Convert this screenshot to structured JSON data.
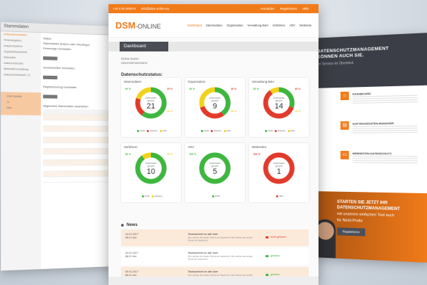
{
  "colors": {
    "accent": "#f27b19",
    "green": "#3fb63f",
    "yellow": "#f2d21b",
    "red": "#e23b2c",
    "dark": "#4a4d55"
  },
  "topbar": {
    "phone": "+49 0 00 0000-0",
    "email": "info@dsm-online.eu",
    "login": "Anmelden",
    "register": "Registrieren",
    "help": "Hilfe"
  },
  "logo": {
    "brand": "DSM",
    "suffix": "-ONLINE",
    "tagline": "Datenschutzmanagement"
  },
  "nav": [
    "Dashboard",
    "Stammdaten",
    "Organisation",
    "Verwaltung B&V",
    "Verfahren",
    "ADV",
    "Webseite"
  ],
  "dashboard": {
    "tab": "Dashboard",
    "user_line1": "Online-Nutzer",
    "user_line2": "Unternehmensname",
    "section_title": "Datenschutzstatus:"
  },
  "cards": [
    {
      "title": "Stammdaten",
      "center_label": "Datensätze",
      "center_label2": "gesamt",
      "value": "21",
      "pcts": [
        "60 %",
        "20 %",
        "20 %"
      ],
      "legend": [
        "erfüllt",
        "teilweise",
        "offen"
      ],
      "segments": [
        {
          "color": "green",
          "frac": 0.6
        },
        {
          "color": "red",
          "frac": 0.2
        },
        {
          "color": "yellow",
          "frac": 0.2
        }
      ]
    },
    {
      "title": "Organisation",
      "center_label": "Datensätze",
      "center_label2": "gesamt",
      "value": "9",
      "pcts": [
        "40 %",
        "30 %",
        "30 %"
      ],
      "legend": [
        "erfüllt",
        "teilweise",
        "offen"
      ],
      "segments": [
        {
          "color": "green",
          "frac": 0.4
        },
        {
          "color": "red",
          "frac": 0.3
        },
        {
          "color": "yellow",
          "frac": 0.3
        }
      ]
    },
    {
      "title": "Verwaltung B&V",
      "center_label": "Datensätze",
      "center_label2": "gesamt",
      "value": "14",
      "pcts": [
        "30 %",
        "60 %",
        "10 %"
      ],
      "legend": [
        "erfüllt",
        "teilweise",
        "offen"
      ],
      "segments": [
        {
          "color": "green",
          "frac": 0.3
        },
        {
          "color": "red",
          "frac": 0.6
        },
        {
          "color": "yellow",
          "frac": 0.1
        }
      ]
    },
    {
      "title": "Verfahren",
      "center_label": "Datensätze",
      "center_label2": "gesamt",
      "value": "10",
      "pcts": [
        "90 %",
        "10 %"
      ],
      "legend": [
        "erfüllt",
        "teilweise"
      ],
      "segments": [
        {
          "color": "green",
          "frac": 0.9
        },
        {
          "color": "yellow",
          "frac": 0.1
        }
      ]
    },
    {
      "title": "ADV",
      "center_label": "Datensätze",
      "center_label2": "gesamt",
      "value": "5",
      "pcts": [
        "100 %"
      ],
      "legend": [
        "erfüllt"
      ],
      "segments": [
        {
          "color": "green",
          "frac": 1.0
        }
      ]
    },
    {
      "title": "Webseiten",
      "center_label": "Datensätze",
      "center_label2": "gesamt",
      "value": "1",
      "pcts": [
        "100 %"
      ],
      "legend": [
        "offen"
      ],
      "segments": [
        {
          "color": "red",
          "frac": 1.0
        }
      ]
    }
  ],
  "news": {
    "title": "News",
    "items": [
      {
        "date": "14.01.2017",
        "time": "08:21 Uhr",
        "headline": "Testnachricht an alle User",
        "text": "Hier stehen die ersten Worte der Nachricht. Hier stehen die ersten Worte der Nachricht.",
        "status": "nicht gelesen",
        "status_color": "red"
      },
      {
        "date": "10.01.2017",
        "time": "08:21 Uhr",
        "headline": "Testnachricht an alle User",
        "text": "Hier stehen die ersten Worte der Nachricht. Hier stehen die ersten Worte der Nachricht.",
        "status": "gelesen",
        "status_color": "green"
      },
      {
        "date": "05.01.2017",
        "time": "08:21 Uhr",
        "headline": "Testnachricht an alle User",
        "text": "Hier stehen die ersten Worte der Nachricht. Hier stehen die ersten Worte der Nachricht.",
        "status": "gelesen",
        "status_color": "green"
      }
    ]
  },
  "left_panel": {
    "title": "Stammdaten",
    "nav": [
      "Unternehmensdaten",
      "Firmenangaben",
      "Ansprechpartner",
      "Organisationseinheit",
      "Webseiten",
      "Datenschutzziele",
      "Mitarbeiterverwaltung",
      "Datenschutzbeauftr. (?)"
    ],
    "side_box": [
      "DSB-Aktivität",
      "Ja",
      "Nein"
    ],
    "heading": "Status",
    "sub": "Stammdaten ändern oder hinzufügen",
    "labels": [
      "Firmenlogo hochladen",
      "Verantwortlich hochladen",
      "Registerauszug hochladen",
      "Allgemeine Stammdaten bearbeiten"
    ],
    "button": "Datei auswählen"
  },
  "right_panel": {
    "hero_line1": "DATENSCHUTZMANAGEMENT",
    "hero_line2": "KÖNNEN AUCH SIE.",
    "hero_sub": "Ihr Service im Überblick",
    "features": [
      {
        "icon": "home-icon",
        "title": "DASHBOARD"
      },
      {
        "icon": "document-icon",
        "title": "AUFTRAGSDATEN-MANAGER"
      },
      {
        "icon": "monitor-icon",
        "title": "WEBSEITEN-DATENSCHUTZ"
      }
    ],
    "cta_title1": "STARTEN SIE JETZT IHR",
    "cta_title2": "DATENSCHUTZMANAGEMENT",
    "cta_text1": "mit unserem einfachen Tool auch",
    "cta_text2": "für Nicht-Profis",
    "cta_button": "Registrieren"
  }
}
